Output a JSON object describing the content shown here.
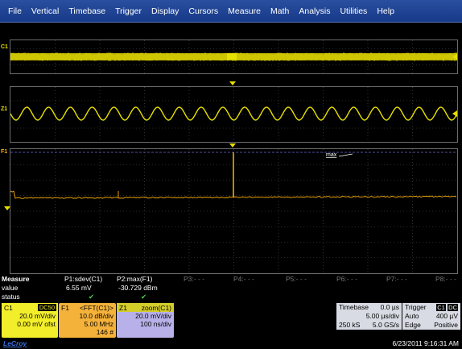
{
  "menu": [
    "File",
    "Vertical",
    "Timebase",
    "Trigger",
    "Display",
    "Cursors",
    "Measure",
    "Math",
    "Analysis",
    "Utilities",
    "Help"
  ],
  "channels": {
    "c1_label": "C1",
    "z1_label": "Z1",
    "f1_label": "F1",
    "max_marker": "max"
  },
  "measure": {
    "title": "Measure",
    "row_value": "value",
    "row_status": "status",
    "params": [
      {
        "name": "P1:sdev(C1)",
        "value": "6.55 mV",
        "status": "✔"
      },
      {
        "name": "P2:max(F1)",
        "value": "-30.729 dBm",
        "status": "✔"
      },
      {
        "name": "P3:- - -",
        "value": "",
        "status": ""
      },
      {
        "name": "P4:- - -",
        "value": "",
        "status": ""
      },
      {
        "name": "P5:- - -",
        "value": "",
        "status": ""
      },
      {
        "name": "P6:- - -",
        "value": "",
        "status": ""
      },
      {
        "name": "P7:- - -",
        "value": "",
        "status": ""
      },
      {
        "name": "P8:- - -",
        "value": "",
        "status": ""
      }
    ]
  },
  "descriptors": {
    "c1": {
      "name": "C1",
      "coupling": "DC50",
      "lines": [
        "20.0 mV/div",
        "0.00 mV ofst"
      ],
      "color": "#f2ee2a"
    },
    "f1": {
      "name": "F1",
      "func": "<FFT(C1)>",
      "lines": [
        "10.0 dB/div",
        "5.00 MHz",
        "146 #"
      ],
      "color": "#f5b23a"
    },
    "z1": {
      "name": "Z1",
      "func": "zoom(C1)",
      "lines": [
        "20.0 mV/div",
        "100 ns/div"
      ],
      "color": "#b8b0e8"
    }
  },
  "timebase": {
    "label": "Timebase",
    "delay": "0.0 µs",
    "per_div": "5.00 µs/div",
    "samples": "250 kS",
    "rate": "5.0 GS/s"
  },
  "trigger": {
    "label": "Trigger",
    "src": "C1",
    "coupling": "DC",
    "mode": "Auto",
    "level": "400 µV",
    "type": "Edge",
    "slope": "Positive"
  },
  "footer": {
    "brand": "LeCroy",
    "datetime": "6/23/2011 9:16:31 AM"
  },
  "colors": {
    "c1": "#e8e000",
    "f1": "#ffb000",
    "grid": "#6d6d6d",
    "menubar": "#1e4294"
  }
}
